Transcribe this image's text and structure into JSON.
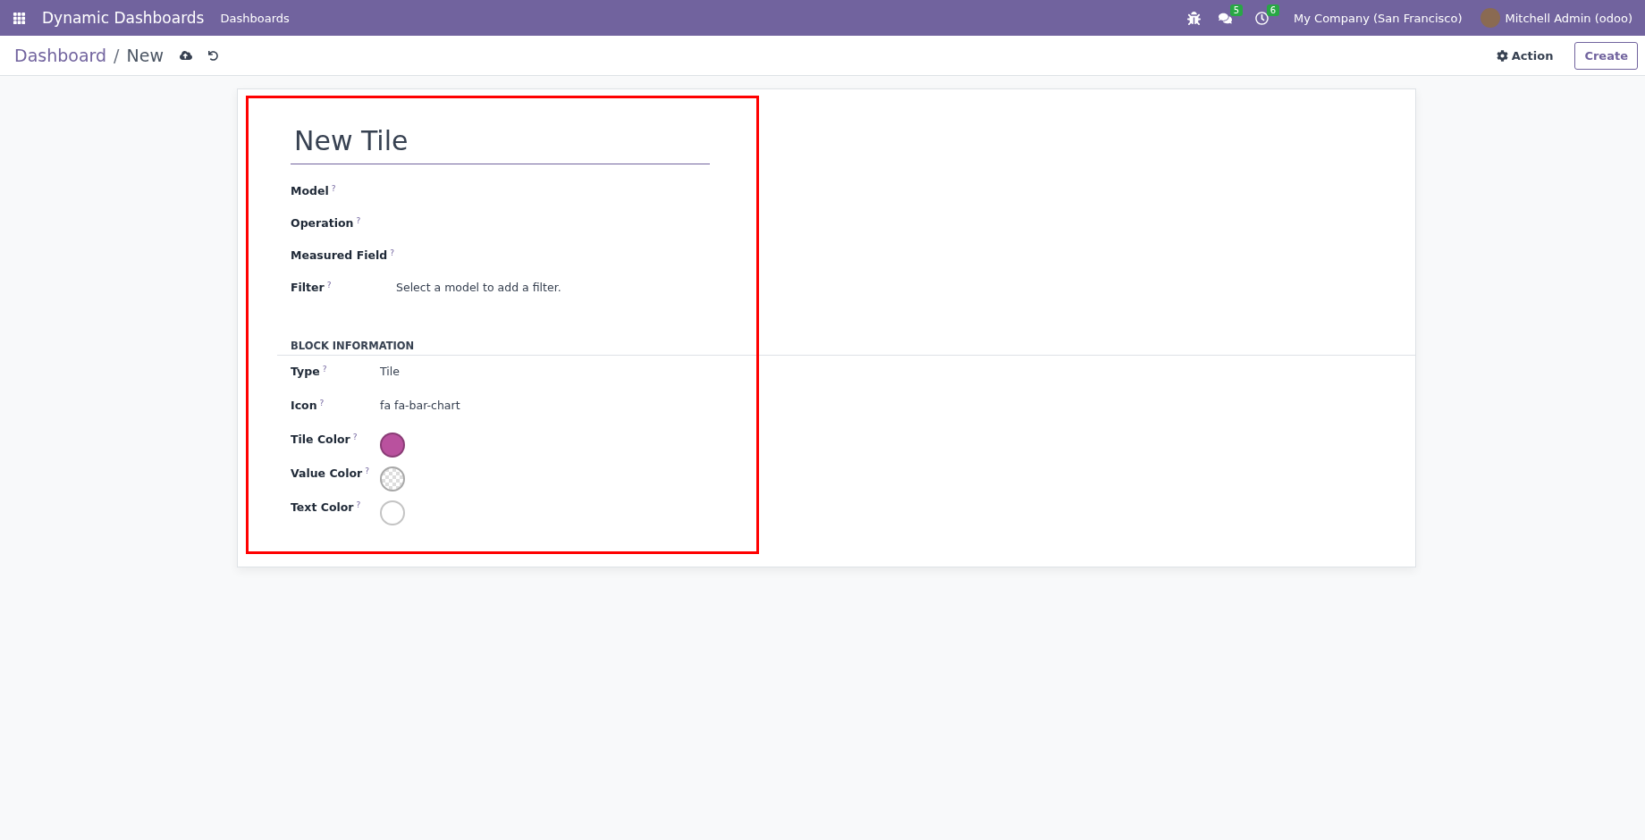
{
  "navbar": {
    "apps_label": "Dynamic Dashboards",
    "menu": [
      "Dashboards"
    ],
    "messages_count": "5",
    "activities_count": "6",
    "company": "My Company (San Francisco)",
    "user": "Mitchell Admin (odoo)"
  },
  "control_panel": {
    "breadcrumb": "Dashboard",
    "current": "New",
    "separator": "/",
    "action_label": "Action",
    "create_label": "Create"
  },
  "form": {
    "title": "New Tile",
    "fields": [
      {
        "label": "Model",
        "help": "?"
      },
      {
        "label": "Operation",
        "help": "?"
      },
      {
        "label": "Measured Field",
        "help": "?"
      },
      {
        "label": "Filter",
        "help": "?",
        "value": "Select a model to add a filter."
      }
    ],
    "section_title": "BLOCK INFORMATION",
    "block_fields": [
      {
        "label": "Type",
        "help": "?",
        "kind": "text",
        "value": "Tile"
      },
      {
        "label": "Icon",
        "help": "?",
        "kind": "text",
        "value": "fa fa-bar-chart"
      },
      {
        "label": "Tile Color",
        "help": "?",
        "kind": "swatch",
        "color": "#b9519e"
      },
      {
        "label": "Value Color",
        "help": "?",
        "kind": "empty"
      },
      {
        "label": "Text Color",
        "help": "?",
        "kind": "swatch",
        "color": "#ffffff"
      }
    ]
  }
}
